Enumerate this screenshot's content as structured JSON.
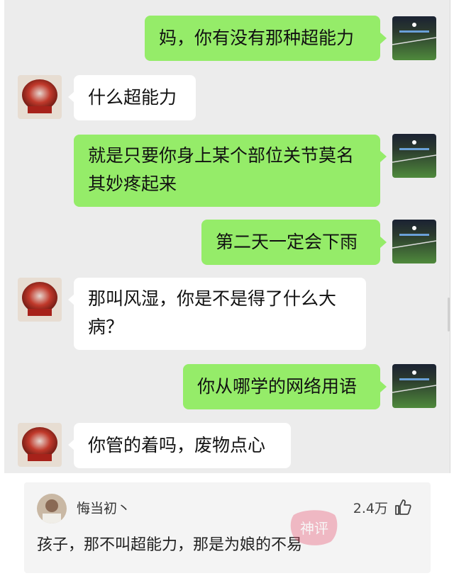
{
  "messages": [
    {
      "side": "me",
      "text": "妈，你有没有那种超能力"
    },
    {
      "side": "them",
      "text": "什么超能力"
    },
    {
      "side": "me",
      "text": "就是只要你身上某个部位关节莫名其妙疼起来"
    },
    {
      "side": "me",
      "text": "第二天一定会下雨"
    },
    {
      "side": "them",
      "text": "那叫风湿，你是不是得了什么大病？"
    },
    {
      "side": "me",
      "text": "你从哪学的网络用语"
    },
    {
      "side": "them",
      "text": "你管的着吗，废物点心"
    }
  ],
  "comment": {
    "username": "悔当初丶",
    "like_count": "2.4万",
    "text": "孩子，那不叫超能力，那是为娘的不易",
    "watermark": "神评"
  },
  "colors": {
    "me_bubble": "#95ec69",
    "them_bubble": "#ffffff",
    "chat_bg": "#ececec"
  },
  "icons": {
    "like": "thumbs-up-icon"
  }
}
